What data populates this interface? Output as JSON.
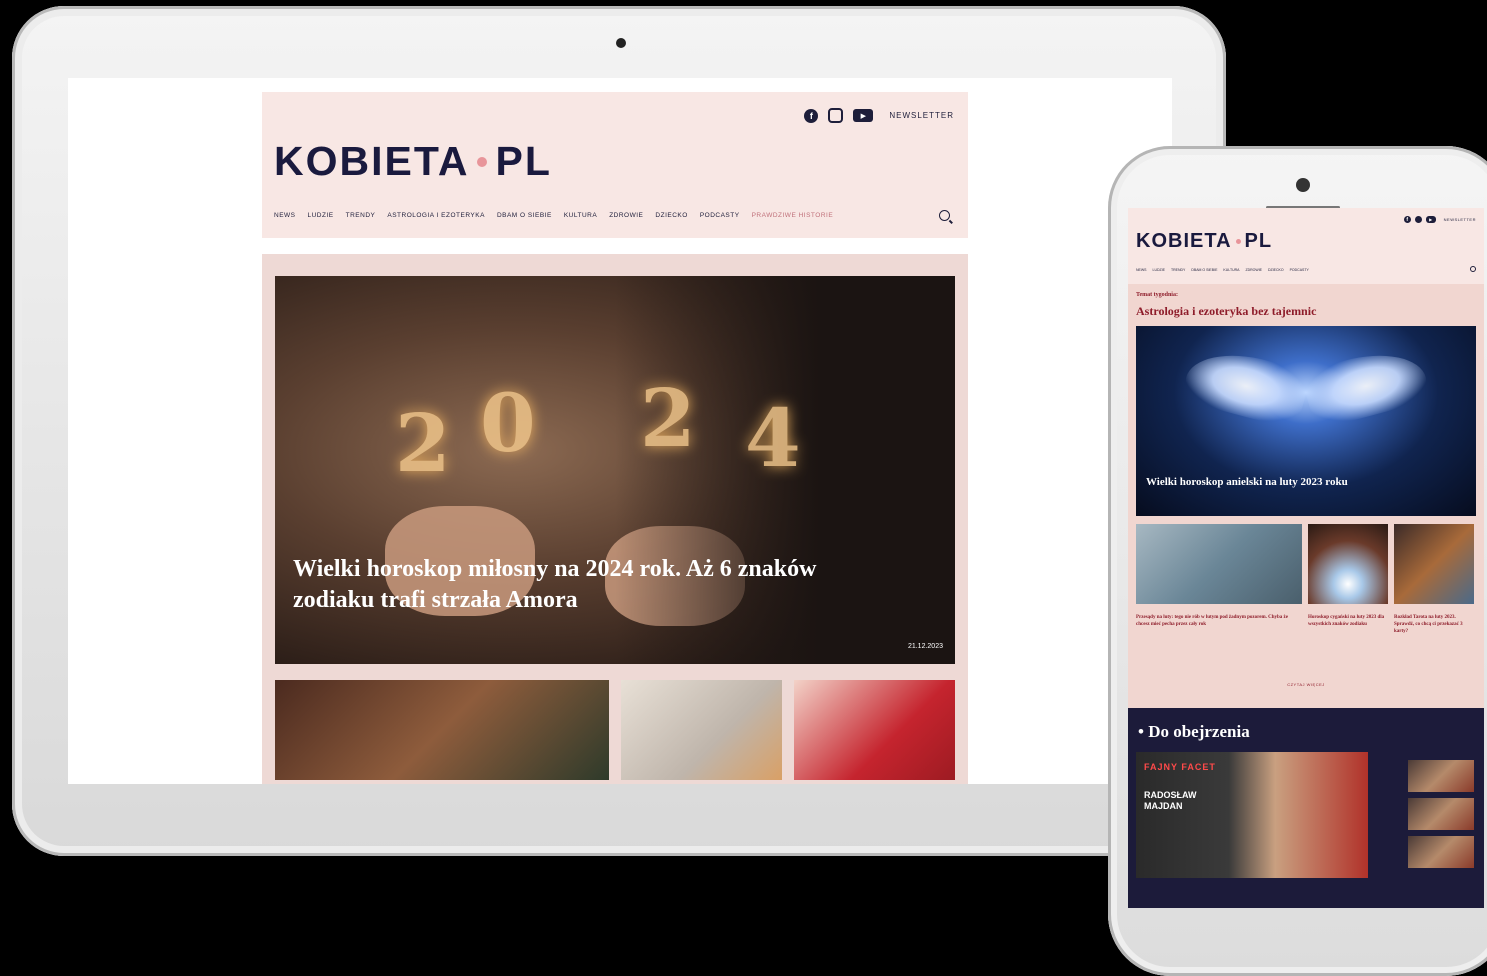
{
  "tablet": {
    "social": {
      "icons": [
        "facebook-icon",
        "instagram-icon",
        "youtube-icon"
      ],
      "newsletter": "NEWSLETTER"
    },
    "logo": {
      "left": "KOBIETA",
      "right": "PL"
    },
    "nav": {
      "items": [
        {
          "label": "NEWS"
        },
        {
          "label": "LUDZIE"
        },
        {
          "label": "TRENDY"
        },
        {
          "label": "ASTROLOGIA I EZOTERYKA"
        },
        {
          "label": "DBAM O SIEBIE"
        },
        {
          "label": "KULTURA"
        },
        {
          "label": "ZDROWIE"
        },
        {
          "label": "DZIECKO"
        },
        {
          "label": "PODCASTY"
        },
        {
          "label": "PRAWDZIWE HISTORIE"
        }
      ]
    },
    "hero": {
      "title": "Wielki horoskop miłosny na 2024 rok. Aż 6 znaków zodiaku trafi strzała Amora",
      "date": "21.12.2023",
      "sparkler_digits": [
        "2",
        "0",
        "2",
        "4"
      ]
    }
  },
  "phone": {
    "social": {
      "newsletter": "NEWSLETTER"
    },
    "logo": {
      "left": "KOBIETA",
      "right": "PL"
    },
    "topic": {
      "label": "Temat tygodnia:",
      "title": "Astrologia i ezoteryka bez tajemnic"
    },
    "hero": {
      "title": "Wielki horoskop anielski na luty 2023 roku"
    },
    "captions": [
      "Przesądy na luty: tego nie rób w lutym pod żadnym pozorem. Chyba że chcesz mieć pecha przez cały rok",
      "Horoskop cygański na luty 2023 dla wszystkich znaków zodiaku",
      "Rozkład Tarota na luty 2023. Sprawdź, co chcą ci przekazać 3 karty?"
    ],
    "more": "CZYTAJ WIĘCEJ",
    "video": {
      "title": "• Do obejrzenia",
      "brand": "FAJNY FACET",
      "guest": "RADOSŁAW MAJDAN"
    }
  },
  "colors": {
    "accent": "#e8959a",
    "navy": "#1a1a3e",
    "headerBg": "#f8e7e4",
    "burgundy": "#8e1c2a"
  }
}
